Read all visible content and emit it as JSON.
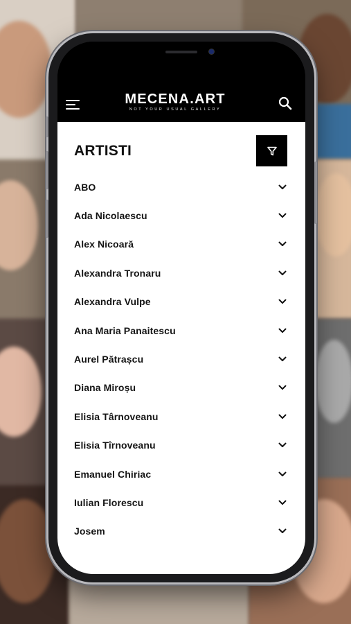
{
  "header": {
    "logo_title": "MECENA.ART",
    "logo_tagline": "NOT YOUR USUAL GALLERY",
    "menu_icon": "hamburger-icon",
    "search_icon": "search-icon"
  },
  "page": {
    "title": "ARTISTI",
    "filter_icon": "filter-icon"
  },
  "artists": [
    {
      "name": "ABO"
    },
    {
      "name": "Ada Nicolaescu"
    },
    {
      "name": "Alex Nicoară"
    },
    {
      "name": "Alexandra Tronaru"
    },
    {
      "name": "Alexandra Vulpe"
    },
    {
      "name": "Ana Maria Panaitescu"
    },
    {
      "name": "Aurel Pătrașcu"
    },
    {
      "name": "Diana Miroșu"
    },
    {
      "name": "Elisia Târnoveanu"
    },
    {
      "name": "Elisia Tîrnoveanu"
    },
    {
      "name": "Emanuel Chiriac"
    },
    {
      "name": "Iulian Florescu"
    },
    {
      "name": "Josem"
    }
  ],
  "colors": {
    "app_bar": "#000000",
    "content_bg": "#ffffff",
    "text": "#141414",
    "accent_button": "#000000"
  }
}
